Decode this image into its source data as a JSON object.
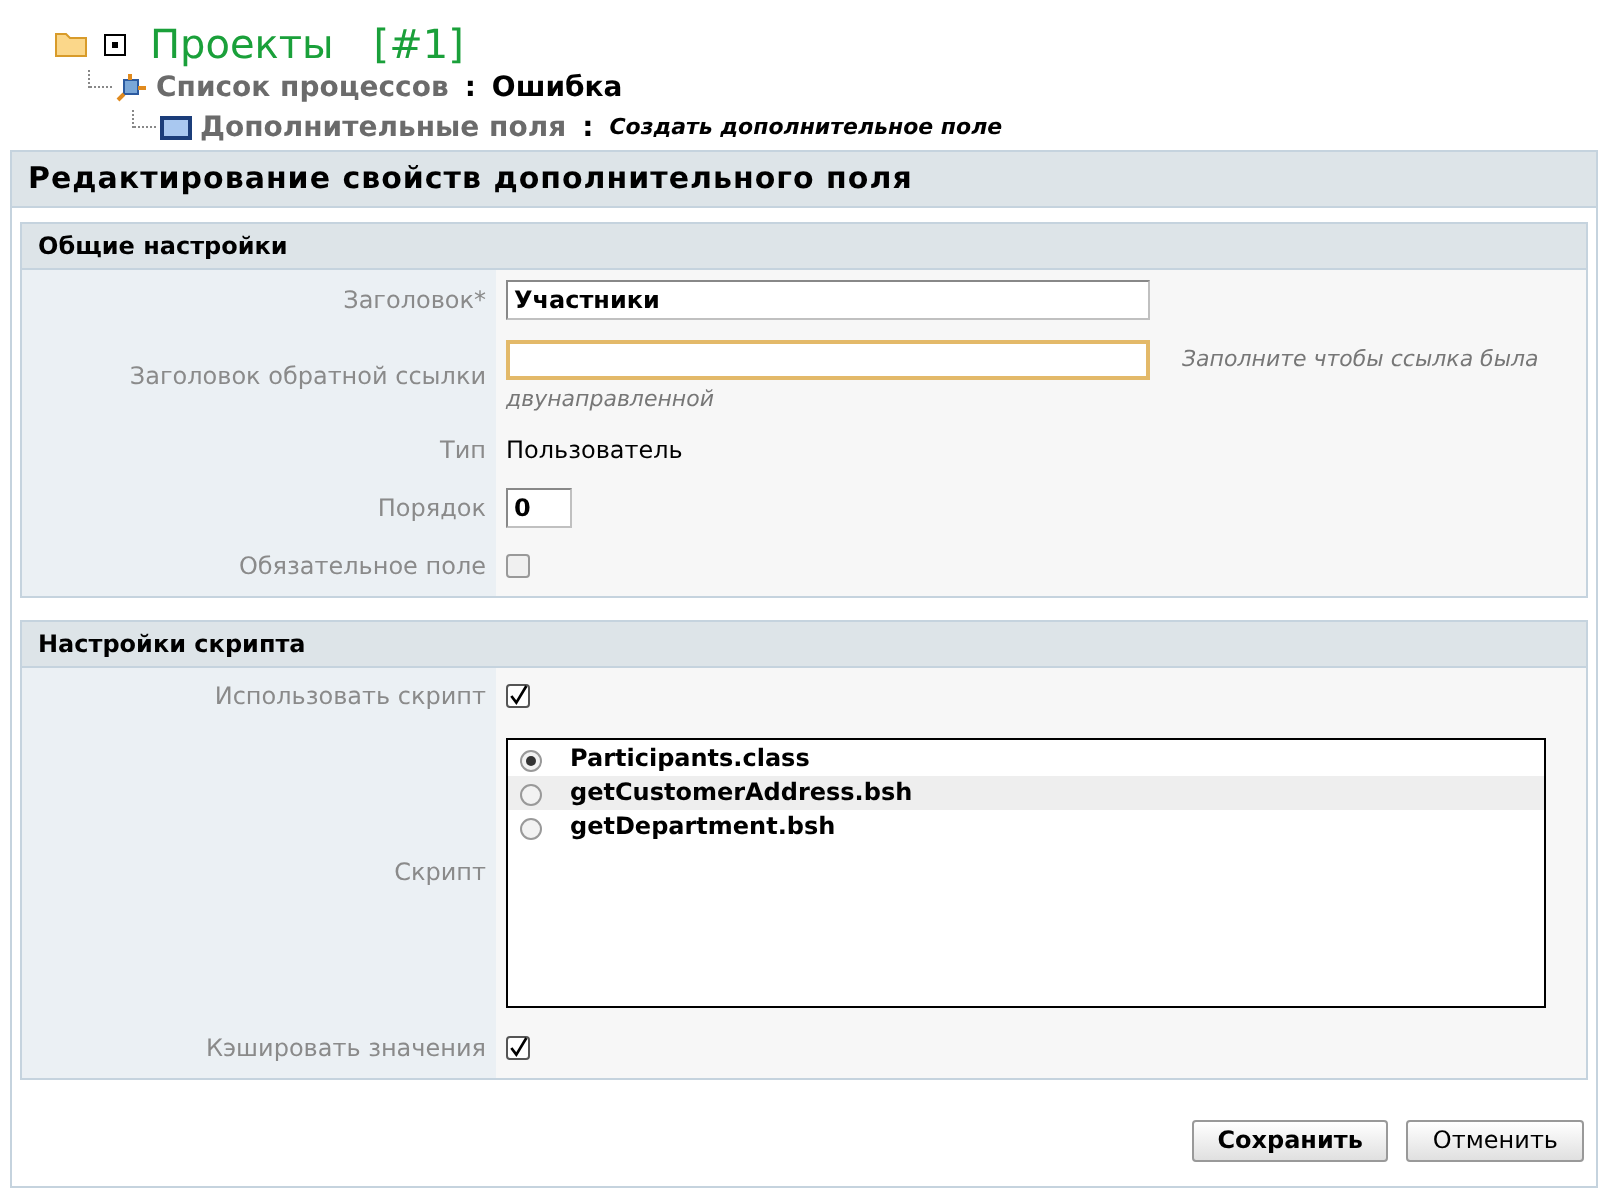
{
  "breadcrumb": {
    "root": {
      "label": "Проекты",
      "number": "[#1]",
      "expanded": true
    },
    "items": [
      {
        "kind": "process",
        "label": "Список процессов",
        "separator": ":",
        "value": "Ошибка"
      },
      {
        "kind": "fields",
        "label": "Дополнительные поля",
        "separator": ":",
        "value": "Создать дополнительное поле"
      }
    ]
  },
  "panel": {
    "title": "Редактирование свойств дополнительного поля",
    "sections": [
      {
        "title": "Общие настройки",
        "rows": [
          {
            "kind": "text",
            "label": "Заголовок*",
            "value": "Участники",
            "focused": false
          },
          {
            "kind": "text",
            "label": "Заголовок обратной ссылки",
            "value": "",
            "focused": true,
            "hint": [
              "Заполните чтобы ссылка была",
              "двунаправленной"
            ]
          },
          {
            "kind": "static",
            "label": "Тип",
            "value": "Пользователь"
          },
          {
            "kind": "number",
            "label": "Порядок",
            "value": "0"
          },
          {
            "kind": "checkbox",
            "label": "Обязательное поле",
            "checked": false
          }
        ]
      },
      {
        "title": "Настройки скрипта",
        "rows": [
          {
            "kind": "checkbox",
            "label": "Использовать скрипт",
            "checked": true
          },
          {
            "kind": "radio_list",
            "label": "Скрипт",
            "options": [
              {
                "label": "Participants.class",
                "selected": true,
                "highlighted": false
              },
              {
                "label": "getCustomerAddress.bsh",
                "selected": false,
                "highlighted": true
              },
              {
                "label": "getDepartment.bsh",
                "selected": false,
                "highlighted": false
              }
            ]
          },
          {
            "kind": "checkbox",
            "label": "Кэшировать значения",
            "checked": true
          }
        ]
      }
    ],
    "buttons": [
      {
        "label": "Сохранить",
        "primary": true
      },
      {
        "label": "Отменить",
        "primary": false
      }
    ]
  }
}
